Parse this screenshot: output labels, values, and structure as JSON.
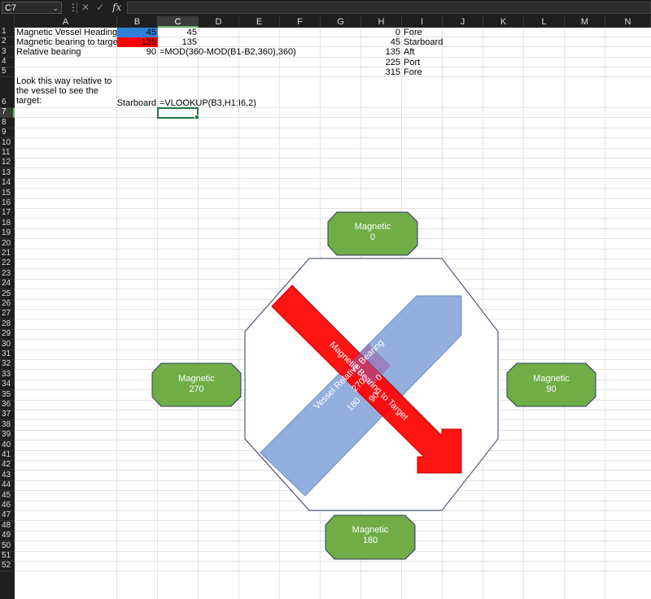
{
  "formula_bar": {
    "name_box": "C7",
    "fx_label": "fx",
    "formula": ""
  },
  "columns": [
    "A",
    "B",
    "C",
    "D",
    "E",
    "F",
    "G",
    "H",
    "I",
    "J",
    "K",
    "L",
    "M",
    "N"
  ],
  "selected_column": "C",
  "selected_row": "7",
  "rows": [
    "1",
    "2",
    "3",
    "4",
    "5",
    "6",
    "7",
    "8",
    "9",
    "10",
    "11",
    "12",
    "13",
    "14",
    "15",
    "16",
    "17",
    "18",
    "19",
    "20",
    "21",
    "22",
    "23",
    "24",
    "25",
    "26",
    "27",
    "28",
    "29",
    "30",
    "31",
    "32",
    "33",
    "34",
    "35",
    "36",
    "37",
    "38",
    "39",
    "40",
    "41",
    "42",
    "43",
    "44",
    "45",
    "46",
    "47",
    "48",
    "49",
    "50",
    "51",
    "52"
  ],
  "cells": {
    "A1": "Magnetic Vessel Heading",
    "B1": "45",
    "C1": "45",
    "A2": "Magnetic bearing to target",
    "B2": "135",
    "C2": "135",
    "A3": "Relative bearing",
    "B3": "90",
    "C3": "=MOD(360-MOD(B1-B2,360),360)",
    "A6_line1": "Look this way relative to",
    "A6_line2": "the vessel to see the",
    "A6_line3": "target:",
    "B6": "Starboard",
    "C6": "=VLOOKUP(B3,H1:I6,2)",
    "H1": "0",
    "I1": "Fore",
    "H2": "45",
    "I2": "Starboard",
    "H3": "135",
    "I3": "Aft",
    "H4": "225",
    "I4": "Port",
    "H5": "315",
    "I5": "Fore"
  },
  "colors": {
    "B1_fill": "#2f7fd6",
    "B2_fill": "#ff0000",
    "compass_green": "#70ad47",
    "vessel_blue": "#8eaadb",
    "target_red": "#ff0000",
    "selection_green": "#217346"
  },
  "shapes": {
    "north_badge": {
      "line1": "Magnetic",
      "line2": "0"
    },
    "east_badge": {
      "line1": "Magnetic",
      "line2": "90"
    },
    "south_badge": {
      "line1": "Magnetic",
      "line2": "180"
    },
    "west_badge": {
      "line1": "Magnetic",
      "line2": "270"
    },
    "vessel_arrow": {
      "label": "Vessel Relative Bearing",
      "marks": [
        "0",
        "90",
        "180",
        "270"
      ]
    },
    "target_arrow": {
      "label": "Magnetic Bearing to Target"
    }
  }
}
